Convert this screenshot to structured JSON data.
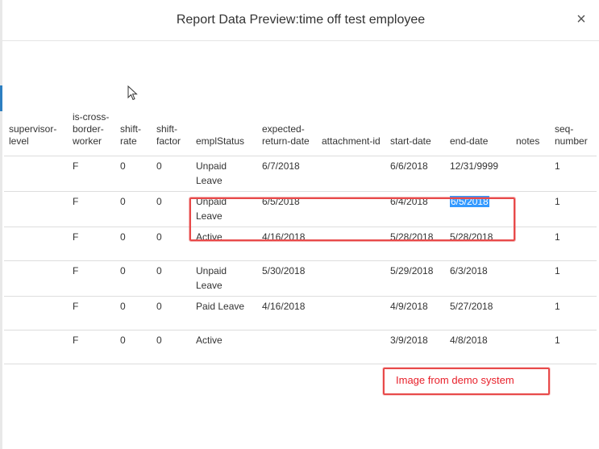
{
  "modal": {
    "title": "Report Data Preview:time off test employee",
    "close_label": "×"
  },
  "table": {
    "headers": {
      "supervisor_level": "supervisor-level",
      "is_cross_border_worker": "is-cross-border-worker",
      "shift_rate": "shift-rate",
      "shift_factor": "shift-factor",
      "empl_status": "emplStatus",
      "expected_return_date": "expected-return-date",
      "attachment_id": "attachment-id",
      "start_date": "start-date",
      "end_date": "end-date",
      "notes": "notes",
      "seq_number": "seq-number"
    },
    "rows": [
      {
        "supervisor_level": "",
        "is_cross_border_worker": "F",
        "shift_rate": "0",
        "shift_factor": "0",
        "empl_status": "Unpaid Leave",
        "expected_return_date": "6/7/2018",
        "attachment_id": "",
        "start_date": "6/6/2018",
        "end_date": "12/31/9999",
        "notes": "",
        "seq_number": "1"
      },
      {
        "supervisor_level": "",
        "is_cross_border_worker": "F",
        "shift_rate": "0",
        "shift_factor": "0",
        "empl_status": "Unpaid Leave",
        "expected_return_date": "6/5/2018",
        "attachment_id": "",
        "start_date": "6/4/2018",
        "end_date": "6/5/2018",
        "notes": "",
        "seq_number": "1"
      },
      {
        "supervisor_level": "",
        "is_cross_border_worker": "F",
        "shift_rate": "0",
        "shift_factor": "0",
        "empl_status": "Active",
        "expected_return_date": "4/16/2018",
        "attachment_id": "",
        "start_date": "5/28/2018",
        "end_date": "5/28/2018",
        "notes": "",
        "seq_number": "1"
      },
      {
        "supervisor_level": "",
        "is_cross_border_worker": "F",
        "shift_rate": "0",
        "shift_factor": "0",
        "empl_status": "Unpaid Leave",
        "expected_return_date": "5/30/2018",
        "attachment_id": "",
        "start_date": "5/29/2018",
        "end_date": "6/3/2018",
        "notes": "",
        "seq_number": "1"
      },
      {
        "supervisor_level": "",
        "is_cross_border_worker": "F",
        "shift_rate": "0",
        "shift_factor": "0",
        "empl_status": "Paid Leave",
        "expected_return_date": "4/16/2018",
        "attachment_id": "",
        "start_date": "4/9/2018",
        "end_date": "5/27/2018",
        "notes": "",
        "seq_number": "1"
      },
      {
        "supervisor_level": "",
        "is_cross_border_worker": "F",
        "shift_rate": "0",
        "shift_factor": "0",
        "empl_status": "Active",
        "expected_return_date": "",
        "attachment_id": "",
        "start_date": "3/9/2018",
        "end_date": "4/8/2018",
        "notes": "",
        "seq_number": "1"
      }
    ]
  },
  "annotation": {
    "demo_note": "Image from demo system"
  },
  "colors": {
    "highlight_border": "#e84a4a",
    "annotation_text": "#e8202a",
    "selection": "#3399ff"
  }
}
